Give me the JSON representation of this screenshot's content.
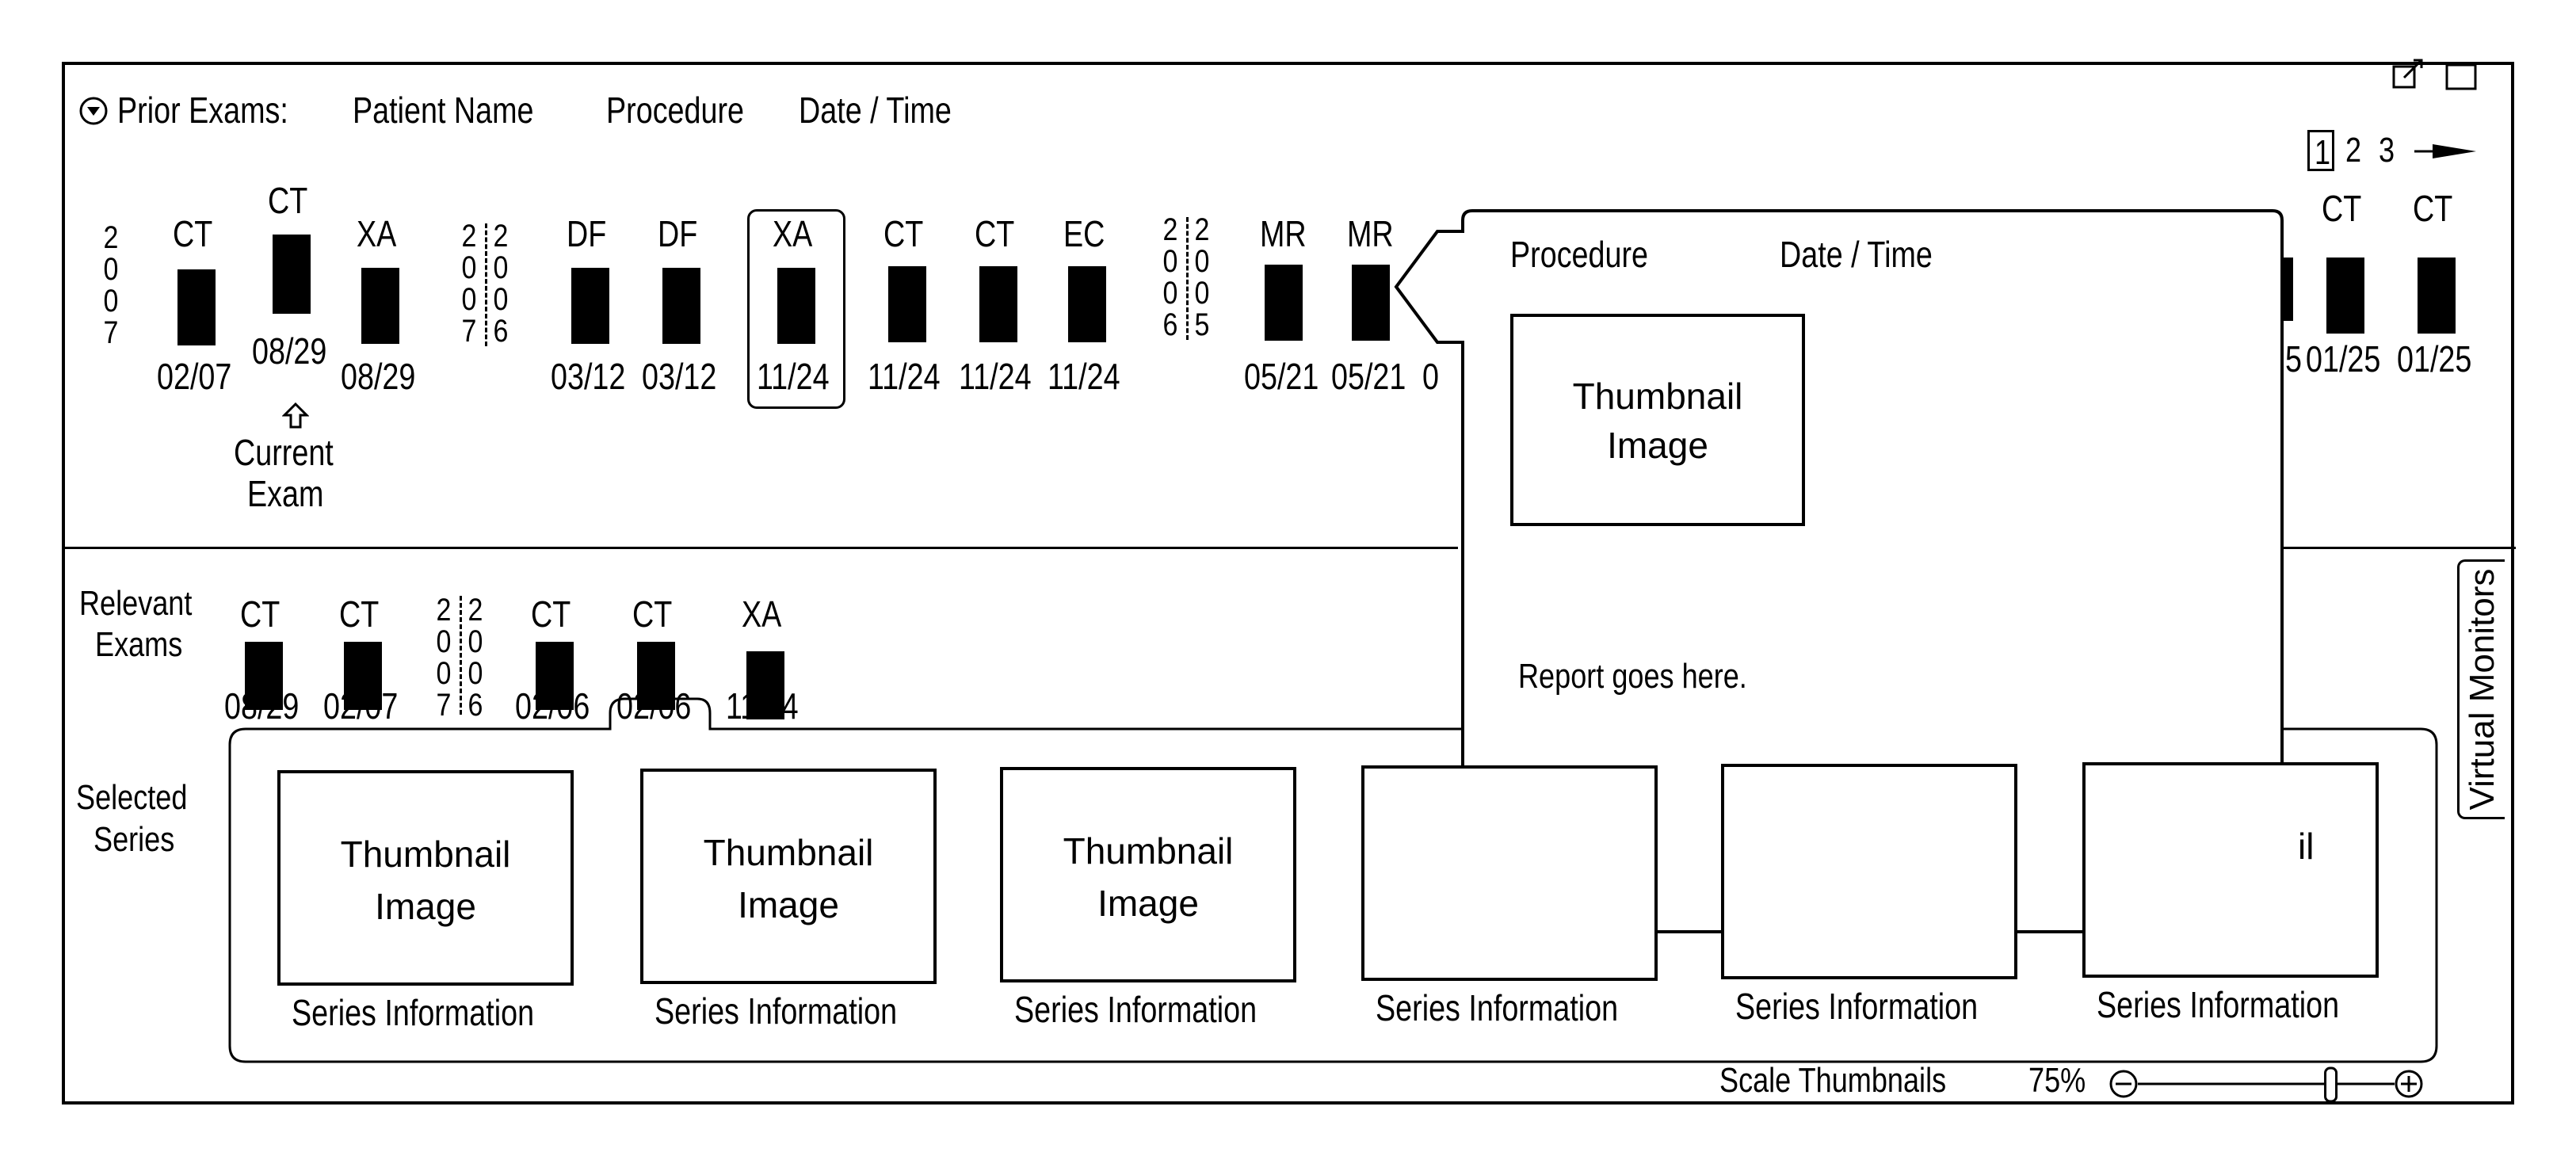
{
  "header": {
    "toggle_icon": "circle-chevron-down-icon",
    "title": "Prior Exams:",
    "columns": [
      "Patient Name",
      "Procedure",
      "Date / Time"
    ]
  },
  "window_controls": {
    "popout_icon": "popout-icon",
    "maximize_icon": "maximize-icon"
  },
  "pager": {
    "pages": [
      "1",
      "2",
      "3"
    ],
    "current": "1",
    "next_icon": "arrow-right-icon"
  },
  "timeline": {
    "year_markers": [
      {
        "digits": [
          "2",
          "0",
          "0",
          "7"
        ]
      },
      {
        "left": [
          "2",
          "0",
          "0",
          "7"
        ],
        "right": [
          "2",
          "0",
          "0",
          "6"
        ]
      },
      {
        "left": [
          "2",
          "0",
          "0",
          "6"
        ],
        "right": [
          "2",
          "0",
          "0",
          "5"
        ]
      }
    ],
    "exams": [
      {
        "modality": "CT",
        "date": "02/07"
      },
      {
        "modality": "CT",
        "date": "08/29",
        "current": true
      },
      {
        "modality": "XA",
        "date": "08/29"
      },
      {
        "modality": "DF",
        "date": "03/12"
      },
      {
        "modality": "DF",
        "date": "03/12"
      },
      {
        "modality": "XA",
        "date": "11/24",
        "selected": true
      },
      {
        "modality": "CT",
        "date": "11/24"
      },
      {
        "modality": "CT",
        "date": "11/24"
      },
      {
        "modality": "EC",
        "date": "11/24"
      },
      {
        "modality": "MR",
        "date": "05/21"
      },
      {
        "modality": "MR",
        "date": "05/21",
        "hovered": true
      },
      {
        "modality": "",
        "date": "0"
      },
      {
        "modality": "",
        "date": "5"
      },
      {
        "modality": "CT",
        "date": "01/25"
      },
      {
        "modality": "CT",
        "date": "01/25"
      }
    ],
    "current_exam_label": [
      "Current",
      "Exam"
    ],
    "current_exam_icon": "arrow-up-icon"
  },
  "popup": {
    "procedure_label": "Procedure",
    "datetime_label": "Date / Time",
    "thumbnail_label": [
      "Thumbnail",
      "Image"
    ],
    "report_text": "Report goes here."
  },
  "relevant": {
    "label": [
      "Relevant",
      "Exams"
    ],
    "year_marker": {
      "left": [
        "2",
        "0",
        "0",
        "7"
      ],
      "right": [
        "2",
        "0",
        "0",
        "6"
      ]
    },
    "exams": [
      {
        "modality": "CT",
        "date": "08/29"
      },
      {
        "modality": "CT",
        "date": "02/07"
      },
      {
        "modality": "CT",
        "date": "02/06"
      },
      {
        "modality": "CT",
        "date": "02/06",
        "selected": true
      },
      {
        "modality": "XA",
        "date": "11/24"
      }
    ]
  },
  "selected_series": {
    "label": [
      "Selected",
      "Series"
    ],
    "thumbnails": [
      {
        "label": [
          "Thumbnail",
          "Image"
        ],
        "info": "Series Information"
      },
      {
        "label": [
          "Thumbnail",
          "Image"
        ],
        "info": "Series Information"
      },
      {
        "label": [
          "Thumbnail",
          "Image"
        ],
        "info": "Series Information"
      },
      {
        "label": [
          "",
          ""
        ],
        "info": "Series Information"
      },
      {
        "label": [
          "",
          ""
        ],
        "info": "Series Information"
      },
      {
        "label": [
          "il",
          ""
        ],
        "info": "Series Information"
      }
    ]
  },
  "scale": {
    "label": "Scale Thumbnails",
    "value": "75%",
    "value_fraction": 0.75,
    "minus_icon": "zoom-out-icon",
    "plus_icon": "zoom-in-icon"
  },
  "side_tab": {
    "label": "Virtual Monitors"
  }
}
